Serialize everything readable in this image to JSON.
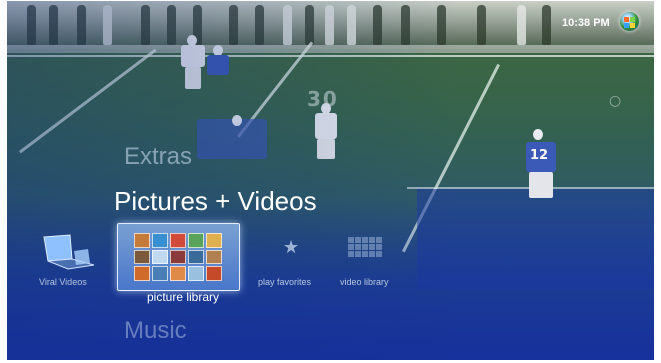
{
  "status": {
    "time": "10:38 PM",
    "start_icon": "windows-orb-icon"
  },
  "menu": {
    "previous": "Extras",
    "current": "Pictures + Videos",
    "next": "Music"
  },
  "tiles": [
    {
      "label": "Viral Videos",
      "icon": "laptop-icon",
      "selected": false
    },
    {
      "label": "picture library",
      "icon": "photo-grid-icon",
      "selected": true
    },
    {
      "label": "play favorites",
      "icon": "star-icon",
      "selected": false
    },
    {
      "label": "video library",
      "icon": "video-grid-icon",
      "selected": false
    }
  ],
  "background": {
    "jersey_number": "12",
    "field_marking": "30"
  },
  "colors": {
    "selection": "#7aa8e6",
    "menu_text": "#ffffff",
    "background_blue": "#1d3896"
  }
}
